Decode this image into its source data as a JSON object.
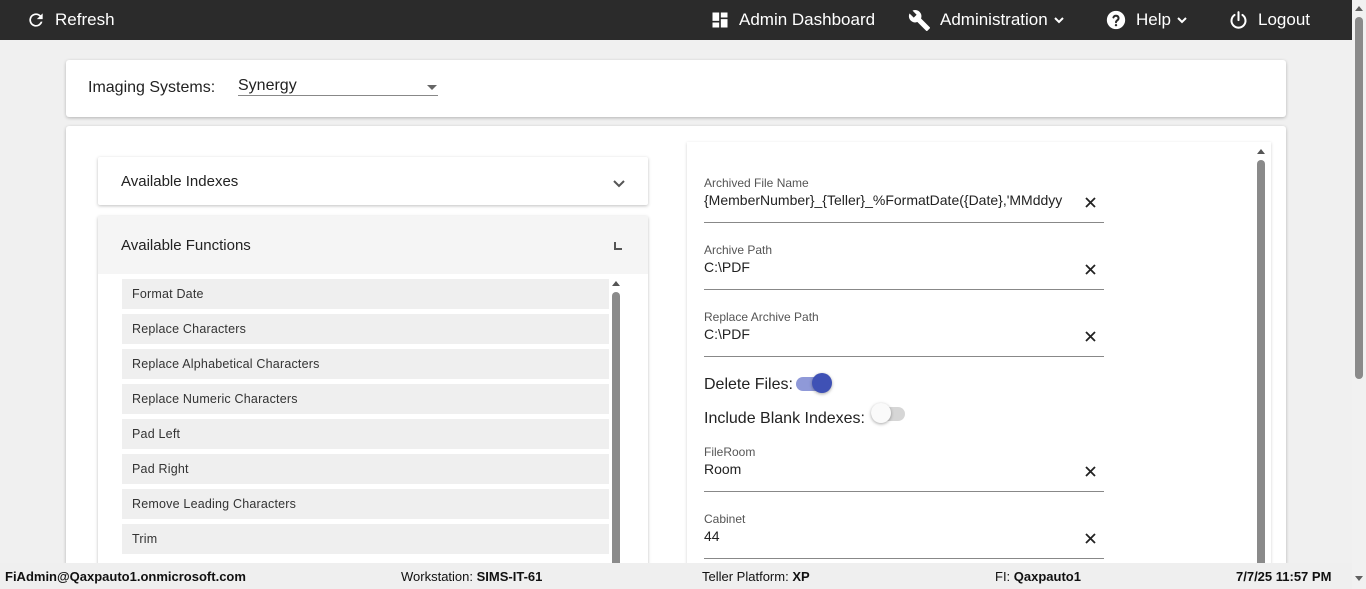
{
  "topbar": {
    "refresh_label": "Refresh",
    "admin_dashboard_label": "Admin Dashboard",
    "administration_label": "Administration",
    "help_label": "Help",
    "logout_label": "Logout"
  },
  "imaging": {
    "label": "Imaging Systems:",
    "selected": "Synergy"
  },
  "left": {
    "indexes_title": "Available Indexes",
    "functions_title": "Available Functions",
    "functions": [
      "Format Date",
      "Replace Characters",
      "Replace Alphabetical Characters",
      "Replace Numeric Characters",
      "Pad Left",
      "Pad Right",
      "Remove Leading Characters",
      "Trim"
    ]
  },
  "right": {
    "archived_file_name": {
      "label": "Archived File Name",
      "value": "{MemberNumber}_{Teller}_%FormatDate({Date},'MMddyy"
    },
    "archive_path": {
      "label": "Archive Path",
      "value": "C:\\PDF"
    },
    "replace_archive_path": {
      "label": "Replace Archive Path",
      "value": "C:\\PDF"
    },
    "delete_files": {
      "label": "Delete Files:",
      "on": true
    },
    "include_blank_indexes": {
      "label": "Include Blank Indexes:",
      "on": false
    },
    "fileroom": {
      "label": "FileRoom",
      "value": "Room"
    },
    "cabinet": {
      "label": "Cabinet",
      "value": "44"
    }
  },
  "status": {
    "user": "FiAdmin@Qaxpauto1.onmicrosoft.com",
    "workstation_label": "Workstation:",
    "workstation_value": "SIMS-IT-61",
    "teller_platform_label": "Teller Platform:",
    "teller_platform_value": "XP",
    "fi_label": "FI:",
    "fi_value": "Qaxpauto1",
    "datetime": "7/7/25 11:57 PM"
  },
  "colors": {
    "topbar_bg": "#2b2b2b",
    "accent": "#3f51b5"
  }
}
